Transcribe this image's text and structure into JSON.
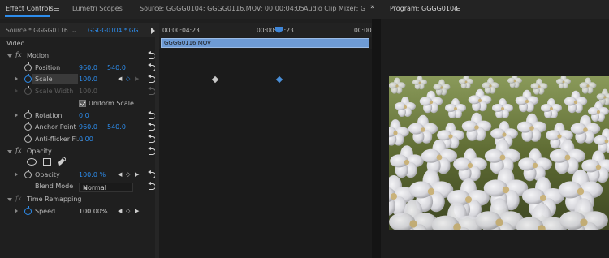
{
  "tabs": {
    "effect_controls": "Effect Controls",
    "lumetri_scopes": "Lumetri Scopes",
    "source": "Source: GGGG0104: GGGG0116.MOV: 00:00:04:05",
    "audio_clip_mixer": "Audio Clip Mixer: G",
    "program": "Program: GGGG0104"
  },
  "source_header": {
    "master": "Source * GGGG0116....",
    "sequence": "GGGG0104 * GG..."
  },
  "timeline": {
    "start_tc": "00:00:04:23",
    "mid_tc": "00:00:05:23",
    "end_tc": "00:00",
    "clip_name": "GGGG0116.MOV"
  },
  "effects": {
    "video_header": "Video",
    "motion": {
      "label": "Motion",
      "position": {
        "label": "Position",
        "x": "960.0",
        "y": "540.0"
      },
      "scale": {
        "label": "Scale",
        "value": "100.0"
      },
      "scale_width": {
        "label": "Scale Width",
        "value": "100.0"
      },
      "uniform_scale": "Uniform Scale",
      "rotation": {
        "label": "Rotation",
        "value": "0.0"
      },
      "anchor_point": {
        "label": "Anchor Point",
        "x": "960.0",
        "y": "540.0"
      },
      "anti_flicker": {
        "label": "Anti-flicker Fi...",
        "value": "0.00"
      }
    },
    "opacity": {
      "label": "Opacity",
      "opacity": {
        "label": "Opacity",
        "value": "100.0 %"
      },
      "blend_mode": {
        "label": "Blend Mode",
        "value": "Normal"
      }
    },
    "time_remapping": {
      "label": "Time Remapping",
      "speed": {
        "label": "Speed",
        "value": "100.00%"
      }
    }
  },
  "colors": {
    "accent": "#2d8ceb",
    "clip": "#6e9bd5"
  }
}
